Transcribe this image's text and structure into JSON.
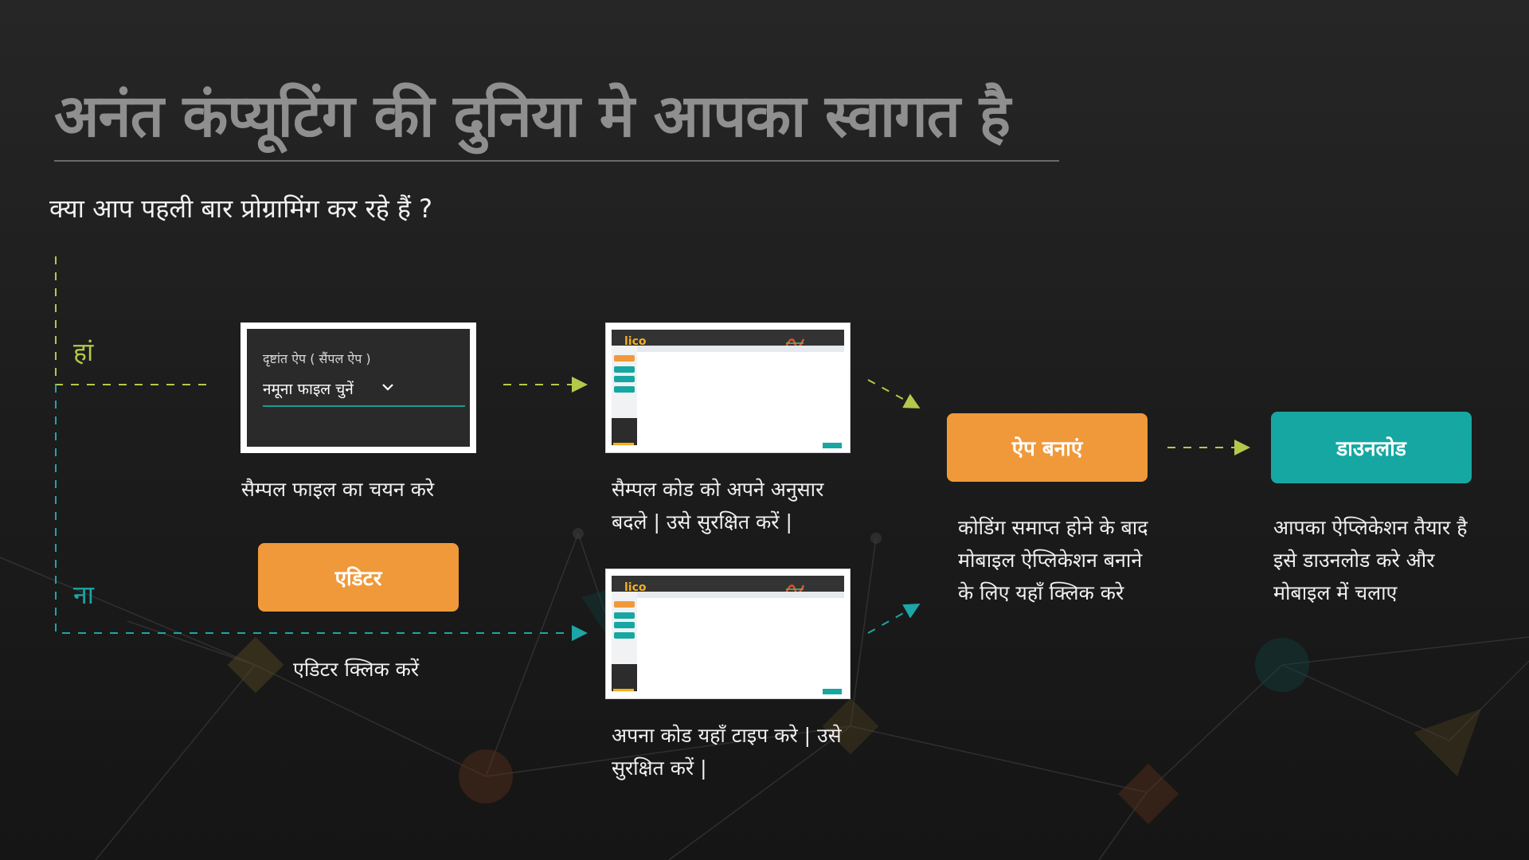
{
  "slide": {
    "title": "अनंत कंप्यूटिंग की दुनिया मे आपका स्वागत है",
    "question": "क्या आप पहली बार प्रोग्रामिंग कर रहे हैं ?"
  },
  "branches": {
    "yes_label": "हां",
    "no_label": "ना"
  },
  "sample_picker": {
    "caption": "दृष्टांत ऐप ( सैंपल ऐप )",
    "selected_value": "नमूना फाइल चुनें",
    "description": "सैम्पल फाइल का चयन करे"
  },
  "editor": {
    "button_label": "एडिटर",
    "description": "एडिटर क्लिक करें"
  },
  "screens": {
    "modify_description": [
      "सैम्पल कोड को अपने अनुसार",
      "बदले | उसे सुरक्षित करें |"
    ],
    "type_description": [
      "अपना कोड यहाँ टाइप करे | उसे",
      "सुरक्षित करें |"
    ]
  },
  "build": {
    "button_label": "ऐप बनाएं",
    "description": [
      "कोडिंग समाप्त होने के बाद",
      "मोबाइल ऐप्लिकेशन बनाने",
      "के लिए यहाँ क्लिक करे"
    ]
  },
  "download": {
    "button_label": "डाउनलोड",
    "description": [
      "आपका ऐप्लिकेशन तैयार है",
      "इसे डाउनलोड करे और",
      "मोबाइल में चलाए"
    ]
  },
  "colors": {
    "accent_orange": "#f0993a",
    "accent_teal": "#17a7a2",
    "yes_green": "#b6c84a",
    "title_gray": "#8f8f8f"
  },
  "icons": [
    "chevron-down-icon",
    "app-logo-icon"
  ]
}
